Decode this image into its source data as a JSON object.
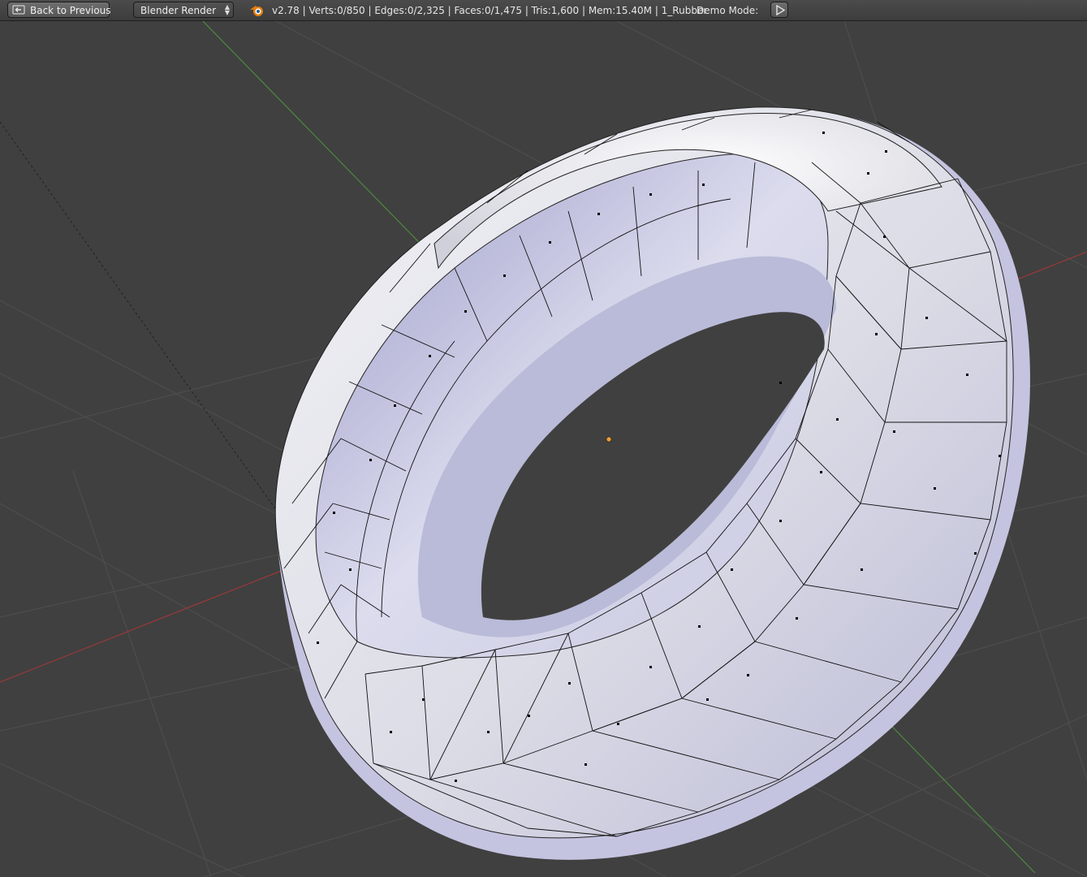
{
  "header": {
    "back_button_label": "Back to Previous",
    "render_engine": "Blender Render",
    "stats": "v2.78 | Verts:0/850 | Edges:0/2,325 | Faces:0/1,475 | Tris:1,600 | Mem:15.40M | 1_Rubber",
    "demo_mode_label": "Demo Mode:"
  },
  "icons": {
    "back": "back-arrow-icon",
    "engine_dropdown": "updown-arrows-icon",
    "blender": "blender-logo-icon",
    "play": "play-icon"
  },
  "viewport": {
    "object": "tire mesh (edit mode)",
    "colors": {
      "background": "#404040",
      "grid": "#4a4a4a",
      "x_axis": "#9c3838",
      "y_axis": "#4c8a3c",
      "mesh_surface": "#d8d8e4",
      "mesh_edges": "#000000",
      "origin": "#f0a030"
    }
  }
}
